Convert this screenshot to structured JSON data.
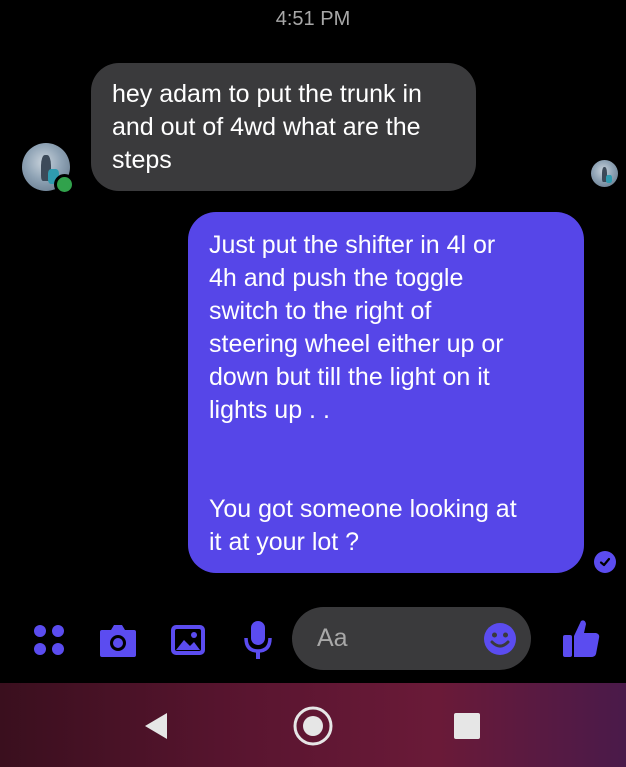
{
  "conversation": {
    "timestamp": "4:51 PM",
    "messages": [
      {
        "direction": "incoming",
        "text": "hey adam to put the trunk in\nand out of 4wd what are the\nsteps"
      },
      {
        "direction": "outgoing",
        "text": "Just put the shifter in 4l or\n4h and push the toggle\nswitch to the right of\nsteering wheel either up or\ndown but till the light on it\nlights up . .\n\n\nYou got someone looking at\nit at your lot ?"
      }
    ],
    "contact_status": "online",
    "outgoing_status": "seen"
  },
  "composer": {
    "placeholder": "Aa",
    "icons": [
      "more-apps-icon",
      "camera-icon",
      "gallery-icon",
      "microphone-icon",
      "emoji-icon",
      "thumbs-up-icon"
    ]
  },
  "navigation_bar": {
    "buttons": [
      "back-icon",
      "home-icon",
      "recents-icon"
    ]
  },
  "colors": {
    "background": "#000000",
    "incoming_bubble": "#3a3a3c",
    "outgoing_bubble": "#5646e8",
    "accent": "#5b4cf0",
    "online": "#31a24c"
  }
}
